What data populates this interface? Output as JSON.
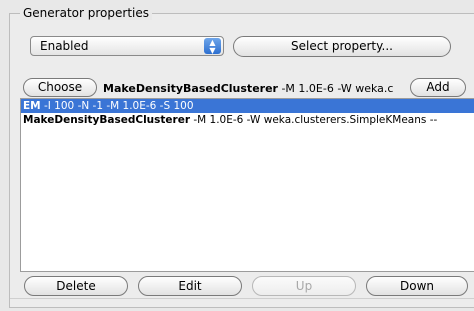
{
  "group": {
    "title": "Generator properties"
  },
  "selector": {
    "value": "Enabled"
  },
  "buttons": {
    "select_property": "Select property...",
    "choose": "Choose",
    "add": "Add",
    "delete": "Delete",
    "edit": "Edit",
    "up": "Up",
    "down": "Down"
  },
  "current": {
    "name": "MakeDensityBasedClusterer",
    "options": " -M 1.0E-6 -W weka.c"
  },
  "list": {
    "items": [
      {
        "name": "EM",
        "options": " -I 100 -N -1 -M 1.0E-6 -S 100"
      },
      {
        "name": "MakeDensityBasedClusterer",
        "options": " -M 1.0E-6 -W weka.clusterers.SimpleKMeans --"
      }
    ]
  },
  "colors": {
    "selection": "#3a75d6",
    "popup_arrow": "#2d6fd0"
  },
  "icons": {
    "popup": "up-down-arrows-icon"
  }
}
